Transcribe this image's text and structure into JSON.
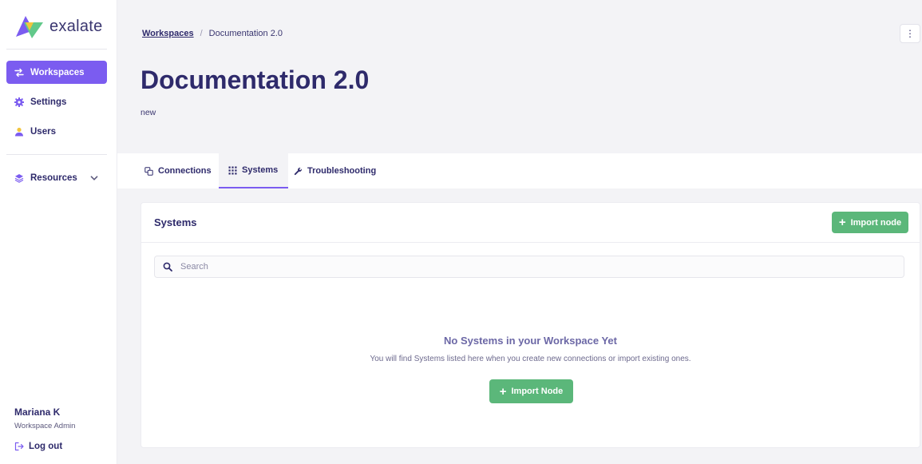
{
  "brand": {
    "name": "exalate"
  },
  "sidebar": {
    "items": [
      {
        "label": "Workspaces",
        "active": true
      },
      {
        "label": "Settings",
        "active": false
      },
      {
        "label": "Users",
        "active": false
      }
    ],
    "resources_label": "Resources",
    "user": {
      "name": "Mariana K",
      "role": "Workspace Admin"
    },
    "logout_label": "Log out"
  },
  "header": {
    "breadcrumb": {
      "parent": "Workspaces",
      "separator": "/",
      "current": "Documentation 2.0"
    },
    "title": "Documentation 2.0",
    "subtitle": "new",
    "more_icon": "⋮"
  },
  "tabs": [
    {
      "label": "Connections",
      "icon": "connections-icon",
      "active": false
    },
    {
      "label": "Systems",
      "icon": "grid-icon",
      "active": true
    },
    {
      "label": "Troubleshooting",
      "icon": "wrench-icon",
      "active": false
    }
  ],
  "systems": {
    "title": "Systems",
    "import_button_label": "Import node",
    "search_placeholder": "Search",
    "empty_title": "No Systems in your Workspace Yet",
    "empty_description": "You will find Systems listed here when you create new connections or import existing ones.",
    "empty_button_label": "Import Node"
  },
  "colors": {
    "accent": "#7b5cf0",
    "primary_text": "#2e2a6b",
    "green": "#5bb77a",
    "background": "#f3f3f6"
  }
}
